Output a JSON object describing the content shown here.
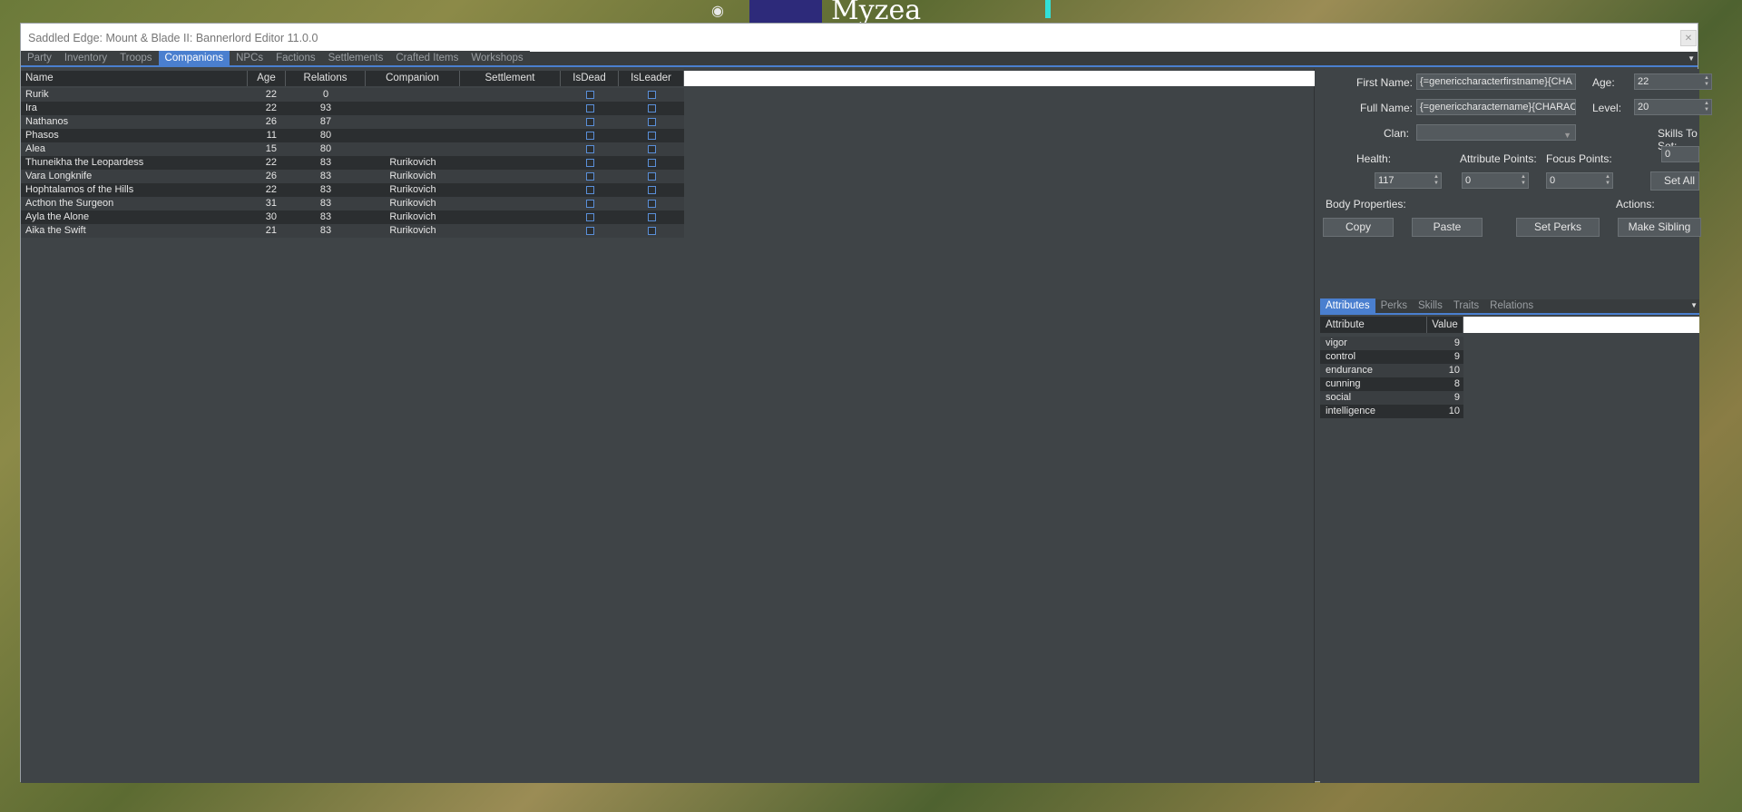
{
  "background": {
    "city_name": "Myzea"
  },
  "window": {
    "title": "Saddled Edge:  Mount & Blade II: Bannerlord Editor 11.0.0"
  },
  "main_tabs": [
    "Party",
    "Inventory",
    "Troops",
    "Companions",
    "NPCs",
    "Factions",
    "Settlements",
    "Crafted Items",
    "Workshops"
  ],
  "active_tab": "Companions",
  "grid": {
    "columns": [
      "Name",
      "Age",
      "Relations",
      "Companion",
      "Settlement",
      "IsDead",
      "IsLeader"
    ],
    "rows": [
      {
        "name": "Rurik",
        "age": "22",
        "relations": "0",
        "companion": "",
        "settlement": ""
      },
      {
        "name": "Ira",
        "age": "22",
        "relations": "93",
        "companion": "",
        "settlement": ""
      },
      {
        "name": "Nathanos",
        "age": "26",
        "relations": "87",
        "companion": "",
        "settlement": ""
      },
      {
        "name": "Phasos",
        "age": "11",
        "relations": "80",
        "companion": "",
        "settlement": ""
      },
      {
        "name": "Alea",
        "age": "15",
        "relations": "80",
        "companion": "",
        "settlement": ""
      },
      {
        "name": "Thuneikha the Leopardess",
        "age": "22",
        "relations": "83",
        "companion": "Rurikovich",
        "settlement": ""
      },
      {
        "name": "Vara Longknife",
        "age": "26",
        "relations": "83",
        "companion": "Rurikovich",
        "settlement": ""
      },
      {
        "name": "Hophtalamos of the Hills",
        "age": "22",
        "relations": "83",
        "companion": "Rurikovich",
        "settlement": ""
      },
      {
        "name": "Acthon the Surgeon",
        "age": "31",
        "relations": "83",
        "companion": "Rurikovich",
        "settlement": ""
      },
      {
        "name": "Ayla the Alone",
        "age": "30",
        "relations": "83",
        "companion": "Rurikovich",
        "settlement": ""
      },
      {
        "name": "Aika the Swift",
        "age": "21",
        "relations": "83",
        "companion": "Rurikovich",
        "settlement": ""
      }
    ]
  },
  "details": {
    "first_name_label": "First Name:",
    "first_name_value": "{=genericcharacterfirstname}{CHA",
    "full_name_label": "Full Name:",
    "full_name_value": "{=genericcharactername}{CHARAC",
    "age_label": "Age:",
    "age_value": "22",
    "level_label": "Level:",
    "level_value": "20",
    "clan_label": "Clan:",
    "clan_value": "",
    "skills_to_set_label": "Skills To Set:",
    "skills_to_set_value": "0",
    "health_label": "Health:",
    "health_value": "117",
    "attribute_points_label": "Attribute Points:",
    "attribute_points_value": "0",
    "focus_points_label": "Focus Points:",
    "focus_points_value": "0",
    "set_all_skills_label": "Set All Skills",
    "body_properties_label": "Body Properties:",
    "actions_label": "Actions:",
    "copy_label": "Copy",
    "paste_label": "Paste",
    "set_perks_label": "Set Perks",
    "make_sibling_label": "Make Sibling"
  },
  "sub_tabs": [
    "Attributes",
    "Perks",
    "Skills",
    "Traits",
    "Relations"
  ],
  "active_sub_tab": "Attributes",
  "attributes": {
    "columns": [
      "Attribute",
      "Value"
    ],
    "rows": [
      {
        "name": "vigor",
        "value": "9"
      },
      {
        "name": "control",
        "value": "9"
      },
      {
        "name": "endurance",
        "value": "10"
      },
      {
        "name": "cunning",
        "value": "8"
      },
      {
        "name": "social",
        "value": "9"
      },
      {
        "name": "intelligence",
        "value": "10"
      }
    ]
  }
}
